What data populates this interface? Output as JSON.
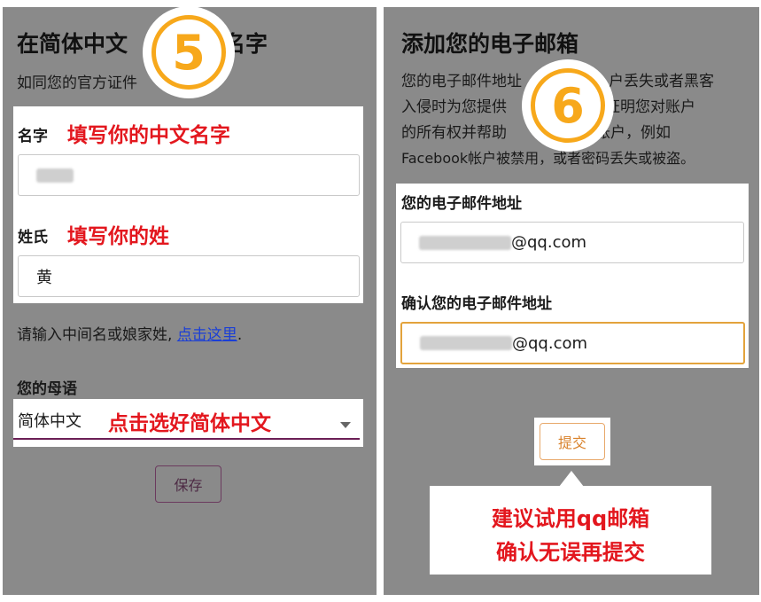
{
  "left": {
    "step_number": "5",
    "title_part1": "在简体中文",
    "title_part2": "名字",
    "subtitle_part1": "如同您的官方证件",
    "first_name": {
      "label": "名字",
      "annotation": "填写你的中文名字"
    },
    "last_name": {
      "label": "姓氏",
      "annotation": "填写你的姓",
      "value": "黄"
    },
    "middle_name_prompt": "请输入中间名或娘家姓, ",
    "middle_name_link": "点击这里",
    "middle_name_suffix": ".",
    "language": {
      "label": "您的母语",
      "selected": "简体中文",
      "annotation": "点击选好简体中文"
    },
    "save_label": "保存"
  },
  "right": {
    "step_number": "6",
    "title": "添加您的电子邮箱",
    "desc_line1_a": "您的电子邮件地址",
    "desc_line1_b": "户丢失或者黑客",
    "desc_line2_a": "入侵时为您提供",
    "desc_line2_b": "来证明您对账户",
    "desc_line3_a": "的所有权并帮助",
    "desc_line3_b": "账户，例如",
    "desc_line4": "Facebook帐户被禁用，或者密码丢失或被盗。",
    "email": {
      "label": "您的电子邮件地址",
      "suffix": "@qq.com"
    },
    "confirm_email": {
      "label": "确认您的电子邮件地址",
      "suffix": "@qq.com"
    },
    "submit_label": "提交",
    "callout_line1": "建议试用qq邮箱",
    "callout_line2": "确认无误再提交"
  },
  "colors": {
    "panel_bg": "#8a8a8a",
    "badge_orange": "#f7a81b",
    "annotation_red": "#e3171e",
    "link_blue": "#1b3fd6",
    "focus_border": "#e3a33c"
  }
}
